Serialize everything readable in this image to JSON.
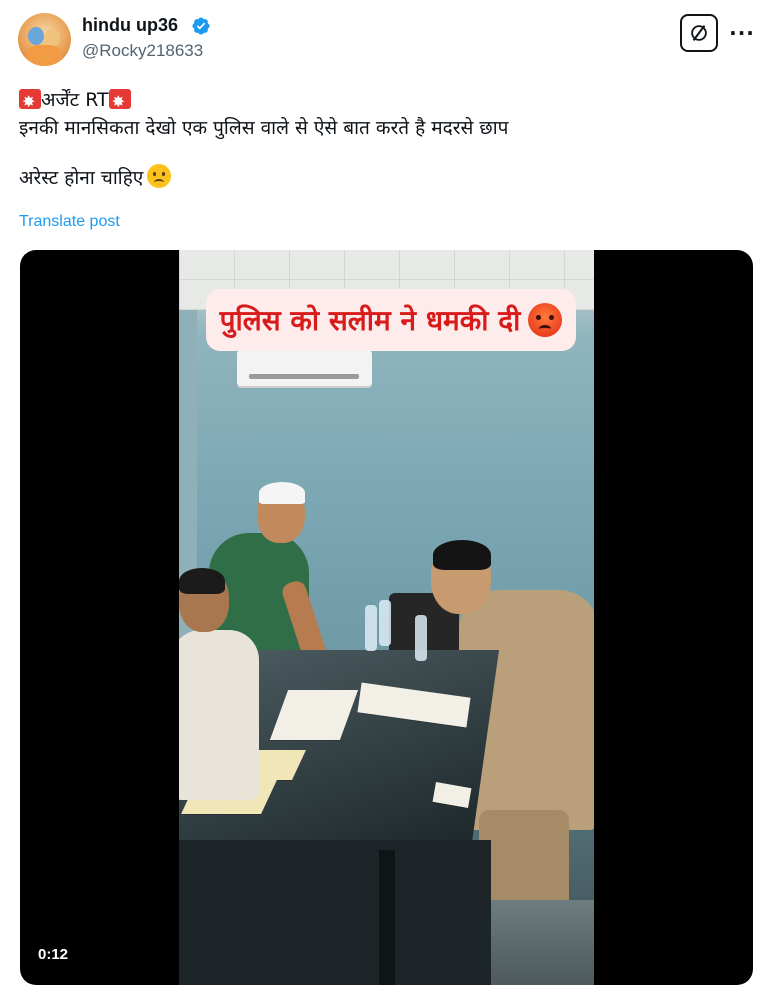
{
  "author": {
    "display_name": "hindu up36",
    "handle": "@Rocky218633",
    "verified": true,
    "avatar_icon": "avatar-illustration"
  },
  "header_actions": {
    "grok_icon": "grok-icon",
    "more_icon": "more-horizontal-icon",
    "more_glyph": "···"
  },
  "post": {
    "line1_text": "अर्जेंट RT",
    "line1_emoji": "rotating-light-emoji",
    "line2_text": "इनकी मानसिकता देखो एक पुलिस वाले से ऐसे बात करते है मदरसे छाप",
    "line3_text": "अरेस्ट होना चाहिए",
    "line3_emoji": "slightly-frowning-face-emoji",
    "translate_label": "Translate post"
  },
  "media": {
    "type": "video",
    "overlay_caption": "पुलिस को सलीम ने धमकी दी",
    "overlay_emoji": "angry-face-emoji",
    "timestamp": "0:12"
  },
  "colors": {
    "text_primary": "#0f1419",
    "text_secondary": "#536471",
    "link": "#1d9bf0",
    "verified": "#1d9bf0",
    "overlay_text": "#d81b1b",
    "media_bg": "#000000"
  }
}
